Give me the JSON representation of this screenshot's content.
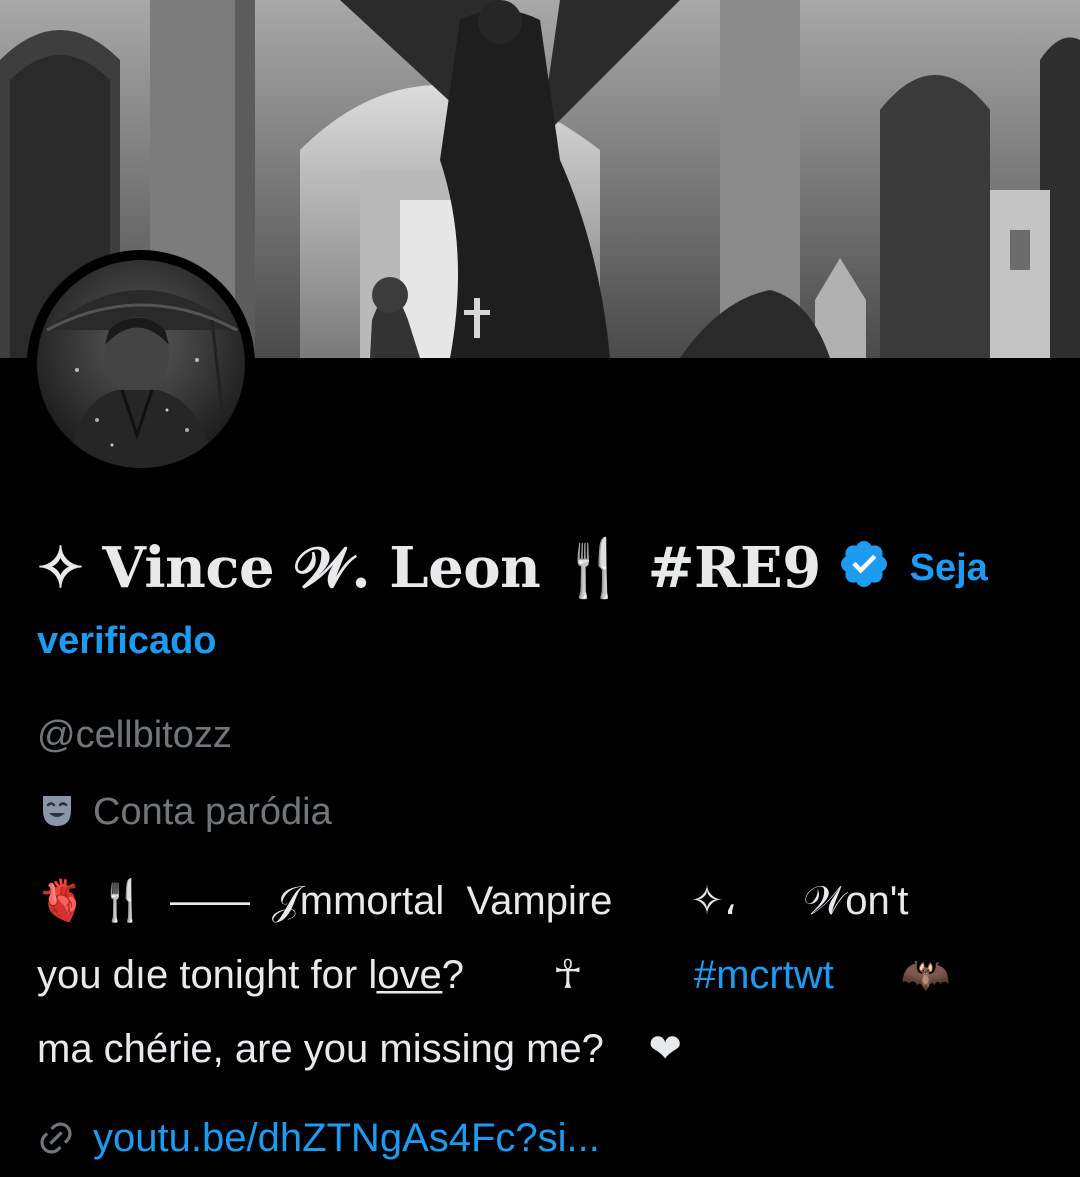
{
  "profile": {
    "display_name": "✧ Vince 𝒲. Leon 🍴 #RE9",
    "get_verified_line1": "Seja",
    "get_verified_line2": "verificado",
    "handle": "@cellbitozz",
    "parody_label": "Conta paródia",
    "bio_lines": [
      "🫀 🍴  ——  𝒥mmortal  Vampire       ✧،      𝒲on't",
      "you dıe tonight for lo̲v̲e̲?        ☥          ",
      "ma chérie, are you missing me?    ❤"
    ],
    "bio_hashtag": "#mcrtwt",
    "bio_bat": "🦇",
    "link": "youtu.be/dhZTNgAs4Fc?si..."
  },
  "icons": {
    "verified": "verified-badge-icon",
    "parody": "theater-masks-icon",
    "link": "link-icon"
  },
  "colors": {
    "background": "#000000",
    "text_primary": "#e7e9ea",
    "text_secondary": "#71767b",
    "accent": "#1d9bf0"
  }
}
